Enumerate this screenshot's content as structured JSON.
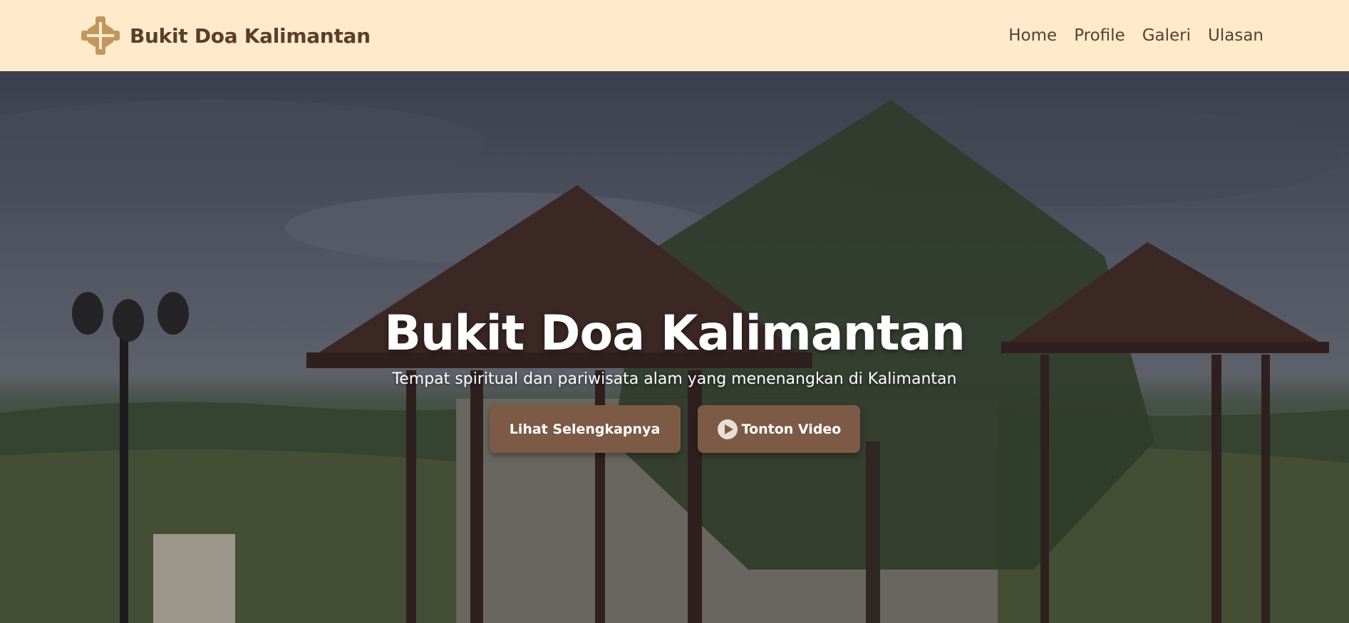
{
  "header": {
    "brand_name": "Bukit Doa Kalimantan",
    "logo_icon": "cross-logo-icon"
  },
  "nav": {
    "items": [
      {
        "label": "Home"
      },
      {
        "label": "Profile"
      },
      {
        "label": "Galeri"
      },
      {
        "label": "Ulasan"
      }
    ]
  },
  "hero": {
    "title": "Bukit Doa Kalimantan",
    "subtitle": "Tempat spiritual dan pariwisata alam yang menenangkan di Kalimantan",
    "primary_button": "Lihat Selengkapnya",
    "video_button": "Tonton Video",
    "video_icon": "play-circle-icon"
  },
  "colors": {
    "nav_bg": "#ffebcc",
    "brand_text": "#5a3e2b",
    "button_bg": "#7d5a45",
    "logo": "#c4965e"
  }
}
